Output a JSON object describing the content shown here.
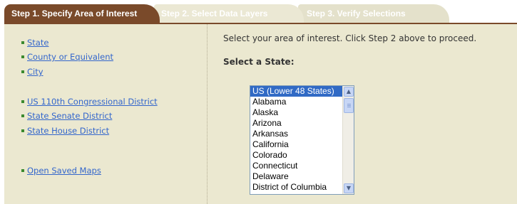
{
  "tabs": [
    {
      "label": "Step 1. Specify Area of Interest",
      "active": true
    },
    {
      "label": "Step 2. Select Data Layers",
      "active": false
    },
    {
      "label": "Step 3. Verify Selections",
      "active": false
    }
  ],
  "sidebar": {
    "links": [
      {
        "label": "State"
      },
      {
        "label": "County or Equivalent"
      },
      {
        "label": "City"
      },
      {
        "label": "US 110th Congressional District"
      },
      {
        "label": "State Senate District"
      },
      {
        "label": "State House District"
      },
      {
        "label": "Open Saved Maps"
      }
    ]
  },
  "main": {
    "instructions": "Select your area of interest. Click Step 2 above to proceed.",
    "select_label": "Select a State:",
    "state_options": [
      "US (Lower 48 States)",
      "Alabama",
      "Alaska",
      "Arizona",
      "Arkansas",
      "California",
      "Colorado",
      "Connecticut",
      "Delaware",
      "District of Columbia"
    ],
    "selected_option": "US (Lower 48 States)"
  },
  "colors": {
    "active_tab": "#7a4a2a",
    "inactive_tab": "#ebe8d4",
    "panel": "#ebe8d0",
    "link": "#3366cc",
    "bullet": "#3b8a2f",
    "selection": "#316ac5"
  },
  "icons": {
    "scroll_up": "chevron-up-icon",
    "scroll_down": "chevron-down-icon"
  }
}
